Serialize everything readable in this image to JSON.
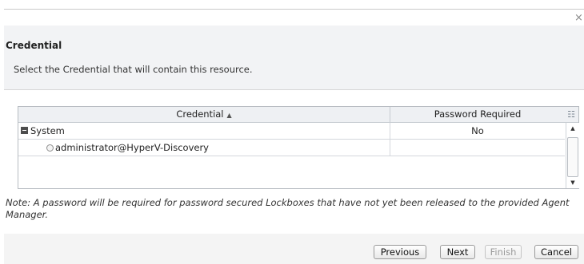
{
  "dialog": {
    "close_glyph": "×",
    "title": "Credential",
    "subtitle": "Select the Credential that will contain this resource."
  },
  "grid": {
    "columns": [
      {
        "label": "Credential",
        "sort": "ascending",
        "sort_glyph": "▲"
      },
      {
        "label": "Password Required"
      }
    ],
    "column_menu_icon": "column-menu-icon",
    "rows": [
      {
        "type": "group",
        "credential": "System",
        "password_required": "No",
        "expanded": true
      },
      {
        "type": "item",
        "credential": "administrator@HyperV-Discovery",
        "password_required": "",
        "selected": false
      }
    ],
    "scrollbar": {
      "up_glyph": "▲",
      "down_glyph": "▼"
    }
  },
  "note": "Note: A password will be required for password secured Lockboxes that have not yet been released to the provided Agent Manager.",
  "footer": {
    "buttons": [
      {
        "label": "Previous",
        "enabled": true
      },
      {
        "label": "Next",
        "enabled": true
      },
      {
        "label": "Finish",
        "enabled": false
      },
      {
        "label": "Cancel",
        "enabled": true
      }
    ]
  }
}
